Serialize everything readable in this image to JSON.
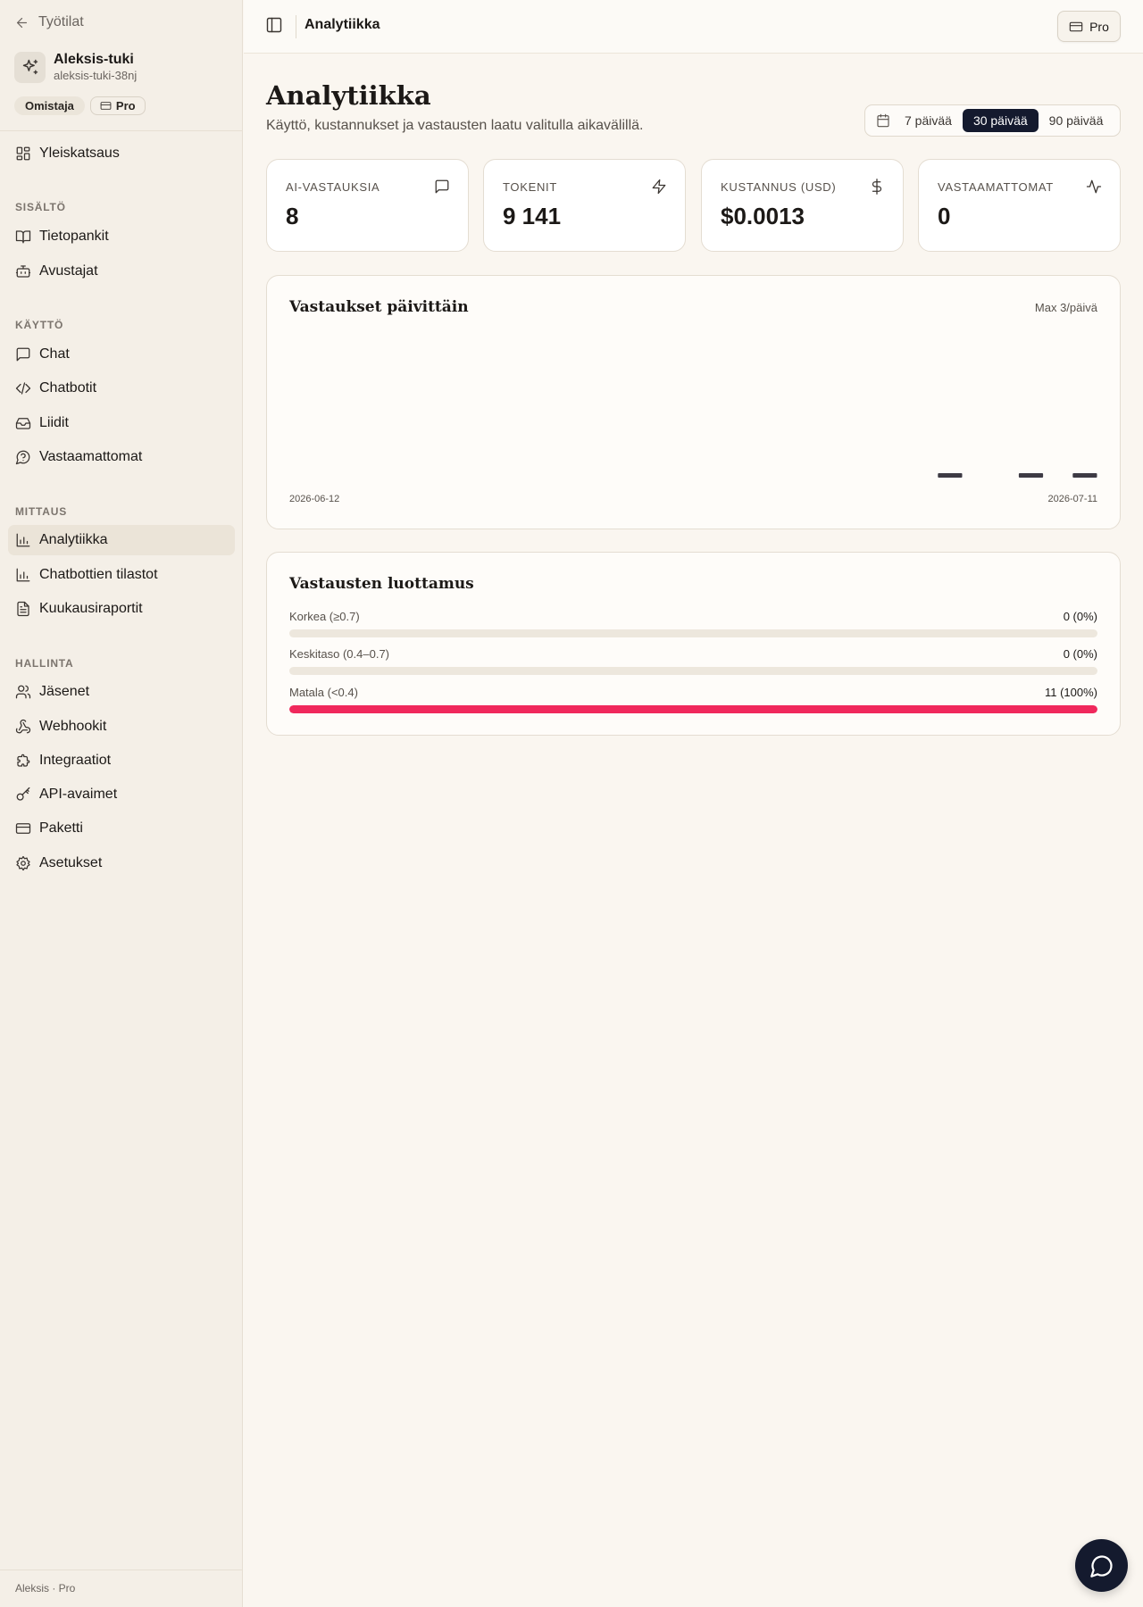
{
  "sidebar": {
    "back_label": "Työtilat",
    "workspace": {
      "name": "Aleksis-tuki",
      "slug": "aleksis-tuki-38nj"
    },
    "badges": {
      "role": "Omistaja",
      "plan": "Pro"
    },
    "overview": {
      "label": "Yleiskatsaus",
      "icon": "grid-icon"
    },
    "sections": [
      {
        "title": "SISÄLTÖ",
        "items": [
          {
            "label": "Tietopankit",
            "icon": "book-icon"
          },
          {
            "label": "Avustajat",
            "icon": "bot-icon"
          }
        ]
      },
      {
        "title": "KÄYTTÖ",
        "items": [
          {
            "label": "Chat",
            "icon": "message-icon"
          },
          {
            "label": "Chatbotit",
            "icon": "code-icon"
          },
          {
            "label": "Liidit",
            "icon": "inbox-icon"
          },
          {
            "label": "Vastaamattomat",
            "icon": "help-circle-icon"
          }
        ]
      },
      {
        "title": "MITTAUS",
        "items": [
          {
            "label": "Analytiikka",
            "icon": "bar-chart-icon",
            "active": true
          },
          {
            "label": "Chatbottien tilastot",
            "icon": "bar-chart-icon"
          },
          {
            "label": "Kuukausiraportit",
            "icon": "file-text-icon"
          }
        ]
      },
      {
        "title": "HALLINTA",
        "items": [
          {
            "label": "Jäsenet",
            "icon": "users-icon"
          },
          {
            "label": "Webhookit",
            "icon": "webhook-icon"
          },
          {
            "label": "Integraatiot",
            "icon": "puzzle-icon"
          },
          {
            "label": "API-avaimet",
            "icon": "key-icon"
          },
          {
            "label": "Paketti",
            "icon": "credit-card-icon"
          },
          {
            "label": "Asetukset",
            "icon": "settings-icon"
          }
        ]
      }
    ],
    "footer": "Aleksis · Pro"
  },
  "topbar": {
    "title": "Analytiikka",
    "plan_button": "Pro"
  },
  "header": {
    "title": "Analytiikka",
    "subtitle": "Käyttö, kustannukset ja vastausten laatu valitulla aikavälillä.",
    "ranges": [
      "7 päivää",
      "30 päivää",
      "90 päivää"
    ],
    "selected_range": "30 päivää"
  },
  "stats": [
    {
      "label": "AI-VASTAUKSIA",
      "value": "8",
      "icon": "message-square-icon"
    },
    {
      "label": "TOKENIT",
      "value": "9 141",
      "icon": "zap-icon"
    },
    {
      "label": "KUSTANNUS (USD)",
      "value": "$0.0013",
      "icon": "dollar-icon"
    },
    {
      "label": "VASTAAMATTOMAT",
      "value": "0",
      "icon": "activity-icon"
    }
  ],
  "daily_chart": {
    "title": "Vastaukset päivittäin",
    "max_label": "Max 3/päivä",
    "start_label": "2026-06-12",
    "end_label": "2026-07-11"
  },
  "chart_data": {
    "type": "bar",
    "x_start": "2026-06-12",
    "x_end": "2026-07-11",
    "days": 30,
    "values": [
      0,
      0,
      0,
      0,
      0,
      0,
      0,
      0,
      0,
      0,
      0,
      0,
      0,
      0,
      0,
      0,
      0,
      0,
      0,
      0,
      0,
      0,
      0,
      0,
      0.1,
      0,
      0,
      0.1,
      0,
      0.1
    ],
    "ylim": [
      0,
      3
    ],
    "bar_color": "#3d3a44"
  },
  "confidence": {
    "title": "Vastausten luottamus",
    "rows": [
      {
        "label": "Korkea (≥0.7)",
        "value": "0 (0%)",
        "fraction": 0,
        "color": "#2f7a4f"
      },
      {
        "label": "Keskitaso (0.4–0.7)",
        "value": "0 (0%)",
        "fraction": 0,
        "color": "#d89a2b"
      },
      {
        "label": "Matala (<0.4)",
        "value": "11 (100%)",
        "fraction": 1,
        "color": "#f0285c"
      }
    ]
  },
  "colors": {
    "accent": "#141a2e",
    "low_confidence": "#f0285c",
    "background": "#faf6f0"
  }
}
